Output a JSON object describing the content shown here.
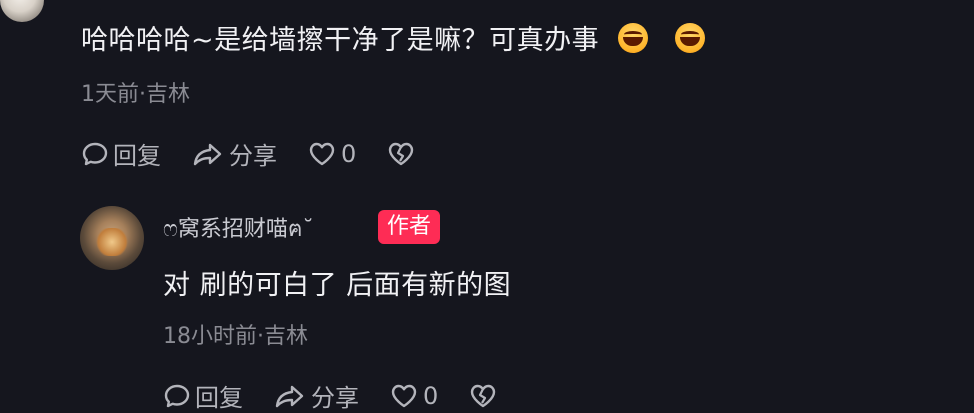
{
  "comment1": {
    "text": "哈哈哈哈~是给墙擦干净了是嘛？可真办事",
    "emojis": [
      "grin-emoji",
      "grin-emoji"
    ],
    "meta": "1天前·吉林",
    "actions": {
      "reply": "回复",
      "share": "分享",
      "like_count": "0"
    }
  },
  "reply1": {
    "username": "ෆ窝系招财喵ฅ˘",
    "badge": "作者",
    "text": "对 刷的可白了 后面有新的图",
    "meta": "18小时前·吉林",
    "actions": {
      "reply": "回复",
      "share": "分享",
      "like_count": "0"
    }
  },
  "colors": {
    "background": "#15161e",
    "badge": "#fe2c55",
    "text": "#f1f1f4",
    "meta": "#8a8b93"
  }
}
